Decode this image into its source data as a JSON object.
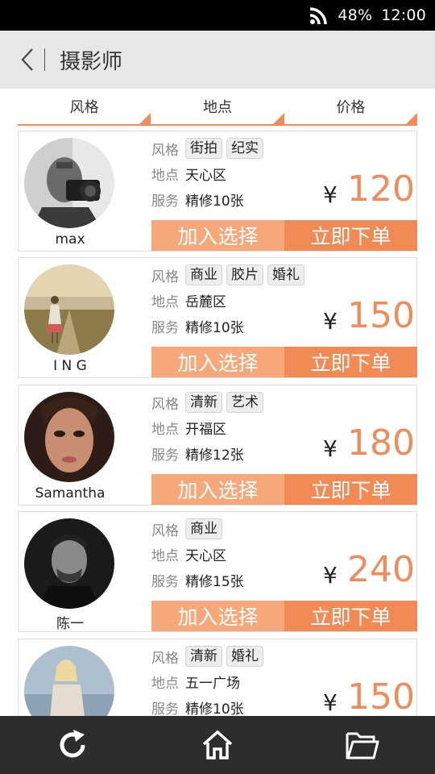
{
  "status_bar": {
    "battery": "48%",
    "time": "12:00"
  },
  "header": {
    "title": "摄影师"
  },
  "filters": [
    {
      "label": "风格"
    },
    {
      "label": "地点"
    },
    {
      "label": "价格"
    }
  ],
  "labels": {
    "style": "风格",
    "location": "地点",
    "service": "服务",
    "currency": "¥",
    "add": "加入选择",
    "order": "立即下单"
  },
  "photographers": [
    {
      "name": "max",
      "tags": [
        "街拍",
        "纪实"
      ],
      "location": "天心区",
      "service": "精修10张",
      "price": "120"
    },
    {
      "name": "I N G",
      "tags": [
        "商业",
        "胶片",
        "婚礼"
      ],
      "location": "岳麓区",
      "service": "精修10张",
      "price": "150"
    },
    {
      "name": "Samantha",
      "tags": [
        "清新",
        "艺术"
      ],
      "location": "开福区",
      "service": "精修12张",
      "price": "180"
    },
    {
      "name": "陈一",
      "tags": [
        "商业"
      ],
      "location": "天心区",
      "service": "精修15张",
      "price": "240"
    },
    {
      "name": "",
      "tags": [
        "清新",
        "婚礼"
      ],
      "location": "五一广场",
      "service": "精修10张",
      "price": "150"
    }
  ],
  "colors": {
    "accent": "#f08c5a",
    "add_button": "#f6a87b",
    "order_button": "#f18a55"
  },
  "bottom_nav": {
    "icons": [
      "refresh-icon",
      "home-icon",
      "folder-icon"
    ]
  }
}
